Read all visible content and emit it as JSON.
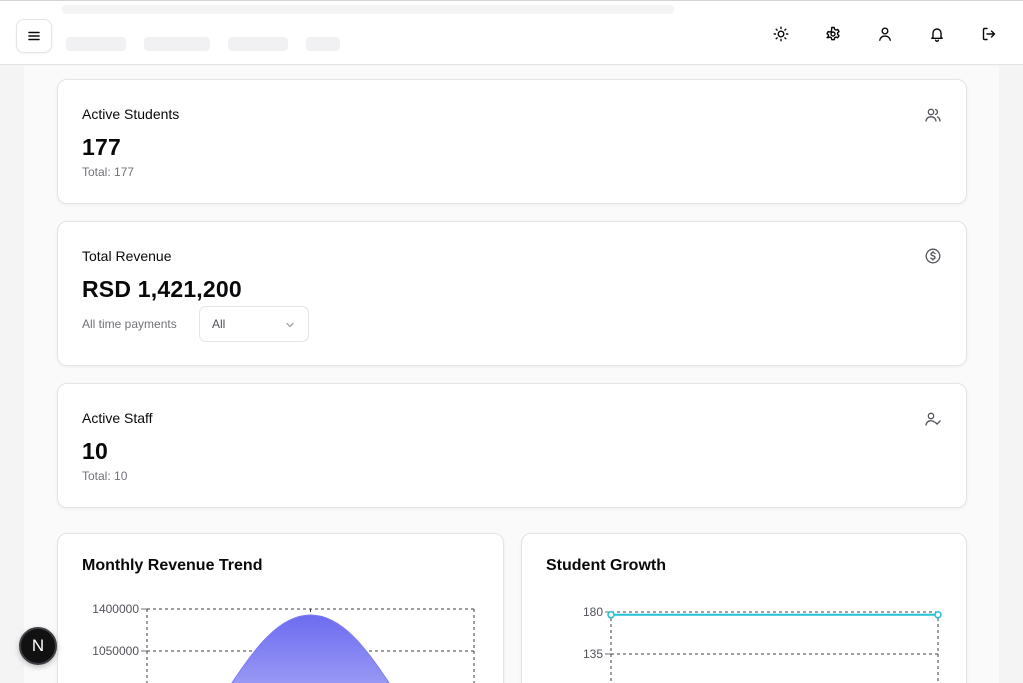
{
  "header": {
    "icons": [
      "menu-icon",
      "sun-icon",
      "gear-icon",
      "user-icon",
      "bell-icon",
      "logout-icon"
    ]
  },
  "cards": {
    "active_students": {
      "title": "Active Students",
      "value": "177",
      "sub": "Total: 177",
      "icon": "users-icon"
    },
    "total_revenue": {
      "title": "Total Revenue",
      "value": "RSD 1,421,200",
      "sub": "All time payments",
      "filter_value": "All",
      "icon": "dollar-circle-icon"
    },
    "active_staff": {
      "title": "Active Staff",
      "value": "10",
      "sub": "Total: 10",
      "icon": "user-check-icon"
    }
  },
  "colors": {
    "revenue_fill": "#7c7cf2",
    "student_line": "#22c1d6"
  },
  "badge": {
    "label": "N"
  },
  "chart_data": [
    {
      "type": "area",
      "title": "Monthly Revenue Trend",
      "y_ticks": [
        "1400000",
        "1050000"
      ],
      "ylim_visible": [
        1050000,
        1400000
      ],
      "x_visible_points": 3,
      "values": [
        null,
        1350000,
        null
      ],
      "grid": true
    },
    {
      "type": "line",
      "title": "Student Growth",
      "y_ticks": [
        "180",
        "135"
      ],
      "values": [
        177,
        177
      ],
      "grid": true
    }
  ]
}
